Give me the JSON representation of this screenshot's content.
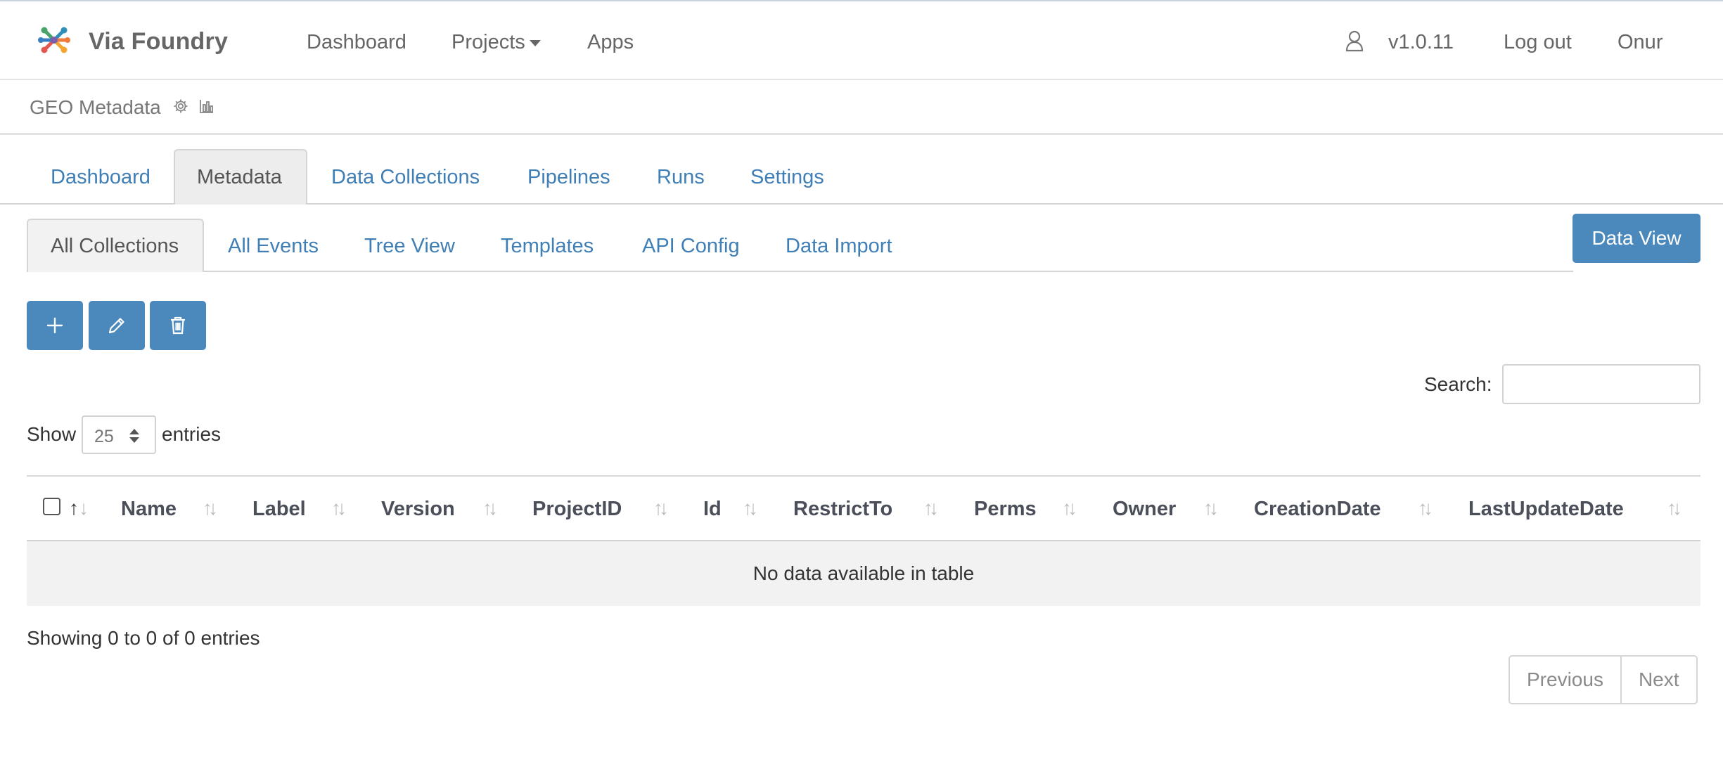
{
  "brand": {
    "name": "Via Foundry",
    "logo": "via-foundry-logo"
  },
  "topnav": {
    "dashboard": "Dashboard",
    "projects": "Projects",
    "apps": "Apps",
    "version": "v1.0.11",
    "logout": "Log out",
    "user": "Onur"
  },
  "project": {
    "name": "GEO Metadata",
    "icons": [
      "gear-icon",
      "bar-chart-icon"
    ]
  },
  "tabs": {
    "dashboard": "Dashboard",
    "metadata": "Metadata",
    "data_collections": "Data Collections",
    "pipelines": "Pipelines",
    "runs": "Runs",
    "settings": "Settings",
    "active": "Metadata"
  },
  "subtabs": {
    "all_collections": "All Collections",
    "all_events": "All Events",
    "tree_view": "Tree View",
    "templates": "Templates",
    "api_config": "API Config",
    "data_import": "Data Import",
    "active": "All Collections"
  },
  "actions": {
    "data_view": "Data View",
    "add_icon": "plus-icon",
    "edit_icon": "pencil-icon",
    "delete_icon": "trash-icon"
  },
  "search": {
    "label": "Search:",
    "value": "",
    "placeholder": ""
  },
  "length": {
    "show": "Show",
    "value": "25",
    "entries": "entries"
  },
  "table": {
    "columns": [
      "Name",
      "Label",
      "Version",
      "ProjectID",
      "Id",
      "RestrictTo",
      "Perms",
      "Owner",
      "CreationDate",
      "LastUpdateDate"
    ],
    "empty_message": "No data available in table",
    "info": "Showing 0 to 0 of 0 entries"
  },
  "pagination": {
    "previous": "Previous",
    "next": "Next"
  },
  "colors": {
    "primary": "#4b89bd",
    "link": "#3f7fb6",
    "muted": "#666666"
  }
}
